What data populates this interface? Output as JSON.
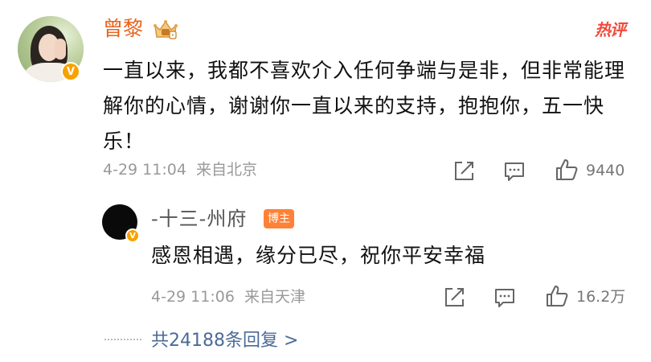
{
  "main_comment": {
    "username": "曾黎",
    "content": "一直以来，我都不喜欢介入任何争端与是非，但非常能理解你的心情，谢谢你一直以来的支持，抱抱你，五一快乐！",
    "hot_label": "热评",
    "timestamp": "4-29 11:04",
    "location": "来自北京",
    "like_count": "9440",
    "verified_mark": "V"
  },
  "reply": {
    "username": "-十三-州府",
    "author_badge": "博主",
    "content": "感恩相遇，缘分已尽，祝你平安幸福",
    "timestamp": "4-29 11:06",
    "location": "来自天津",
    "like_count": "16.2万",
    "verified_mark": "V"
  },
  "replies_link": "共24188条回复 >",
  "colors": {
    "username_orange": "#e8631c",
    "hot_red": "#f24a3d",
    "link_blue": "#4b6b97",
    "badge_orange": "#ff8137",
    "verified_gold": "#f7a200"
  },
  "icons": [
    "crown-icon",
    "share-icon",
    "comment-icon",
    "like-icon",
    "verified-icon"
  ]
}
